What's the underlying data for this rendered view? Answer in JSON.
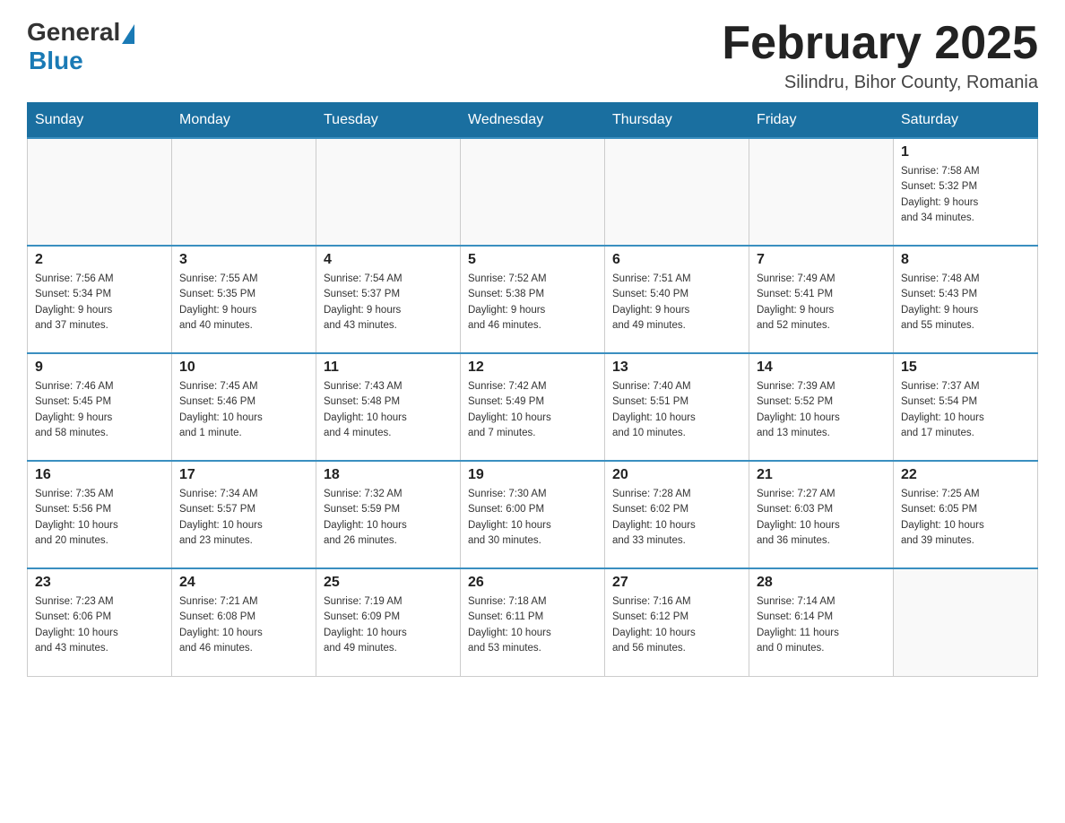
{
  "logo": {
    "general": "General",
    "blue": "Blue"
  },
  "title": "February 2025",
  "location": "Silindru, Bihor County, Romania",
  "days_of_week": [
    "Sunday",
    "Monday",
    "Tuesday",
    "Wednesday",
    "Thursday",
    "Friday",
    "Saturday"
  ],
  "weeks": [
    [
      {
        "day": "",
        "info": ""
      },
      {
        "day": "",
        "info": ""
      },
      {
        "day": "",
        "info": ""
      },
      {
        "day": "",
        "info": ""
      },
      {
        "day": "",
        "info": ""
      },
      {
        "day": "",
        "info": ""
      },
      {
        "day": "1",
        "info": "Sunrise: 7:58 AM\nSunset: 5:32 PM\nDaylight: 9 hours\nand 34 minutes."
      }
    ],
    [
      {
        "day": "2",
        "info": "Sunrise: 7:56 AM\nSunset: 5:34 PM\nDaylight: 9 hours\nand 37 minutes."
      },
      {
        "day": "3",
        "info": "Sunrise: 7:55 AM\nSunset: 5:35 PM\nDaylight: 9 hours\nand 40 minutes."
      },
      {
        "day": "4",
        "info": "Sunrise: 7:54 AM\nSunset: 5:37 PM\nDaylight: 9 hours\nand 43 minutes."
      },
      {
        "day": "5",
        "info": "Sunrise: 7:52 AM\nSunset: 5:38 PM\nDaylight: 9 hours\nand 46 minutes."
      },
      {
        "day": "6",
        "info": "Sunrise: 7:51 AM\nSunset: 5:40 PM\nDaylight: 9 hours\nand 49 minutes."
      },
      {
        "day": "7",
        "info": "Sunrise: 7:49 AM\nSunset: 5:41 PM\nDaylight: 9 hours\nand 52 minutes."
      },
      {
        "day": "8",
        "info": "Sunrise: 7:48 AM\nSunset: 5:43 PM\nDaylight: 9 hours\nand 55 minutes."
      }
    ],
    [
      {
        "day": "9",
        "info": "Sunrise: 7:46 AM\nSunset: 5:45 PM\nDaylight: 9 hours\nand 58 minutes."
      },
      {
        "day": "10",
        "info": "Sunrise: 7:45 AM\nSunset: 5:46 PM\nDaylight: 10 hours\nand 1 minute."
      },
      {
        "day": "11",
        "info": "Sunrise: 7:43 AM\nSunset: 5:48 PM\nDaylight: 10 hours\nand 4 minutes."
      },
      {
        "day": "12",
        "info": "Sunrise: 7:42 AM\nSunset: 5:49 PM\nDaylight: 10 hours\nand 7 minutes."
      },
      {
        "day": "13",
        "info": "Sunrise: 7:40 AM\nSunset: 5:51 PM\nDaylight: 10 hours\nand 10 minutes."
      },
      {
        "day": "14",
        "info": "Sunrise: 7:39 AM\nSunset: 5:52 PM\nDaylight: 10 hours\nand 13 minutes."
      },
      {
        "day": "15",
        "info": "Sunrise: 7:37 AM\nSunset: 5:54 PM\nDaylight: 10 hours\nand 17 minutes."
      }
    ],
    [
      {
        "day": "16",
        "info": "Sunrise: 7:35 AM\nSunset: 5:56 PM\nDaylight: 10 hours\nand 20 minutes."
      },
      {
        "day": "17",
        "info": "Sunrise: 7:34 AM\nSunset: 5:57 PM\nDaylight: 10 hours\nand 23 minutes."
      },
      {
        "day": "18",
        "info": "Sunrise: 7:32 AM\nSunset: 5:59 PM\nDaylight: 10 hours\nand 26 minutes."
      },
      {
        "day": "19",
        "info": "Sunrise: 7:30 AM\nSunset: 6:00 PM\nDaylight: 10 hours\nand 30 minutes."
      },
      {
        "day": "20",
        "info": "Sunrise: 7:28 AM\nSunset: 6:02 PM\nDaylight: 10 hours\nand 33 minutes."
      },
      {
        "day": "21",
        "info": "Sunrise: 7:27 AM\nSunset: 6:03 PM\nDaylight: 10 hours\nand 36 minutes."
      },
      {
        "day": "22",
        "info": "Sunrise: 7:25 AM\nSunset: 6:05 PM\nDaylight: 10 hours\nand 39 minutes."
      }
    ],
    [
      {
        "day": "23",
        "info": "Sunrise: 7:23 AM\nSunset: 6:06 PM\nDaylight: 10 hours\nand 43 minutes."
      },
      {
        "day": "24",
        "info": "Sunrise: 7:21 AM\nSunset: 6:08 PM\nDaylight: 10 hours\nand 46 minutes."
      },
      {
        "day": "25",
        "info": "Sunrise: 7:19 AM\nSunset: 6:09 PM\nDaylight: 10 hours\nand 49 minutes."
      },
      {
        "day": "26",
        "info": "Sunrise: 7:18 AM\nSunset: 6:11 PM\nDaylight: 10 hours\nand 53 minutes."
      },
      {
        "day": "27",
        "info": "Sunrise: 7:16 AM\nSunset: 6:12 PM\nDaylight: 10 hours\nand 56 minutes."
      },
      {
        "day": "28",
        "info": "Sunrise: 7:14 AM\nSunset: 6:14 PM\nDaylight: 11 hours\nand 0 minutes."
      },
      {
        "day": "",
        "info": ""
      }
    ]
  ]
}
